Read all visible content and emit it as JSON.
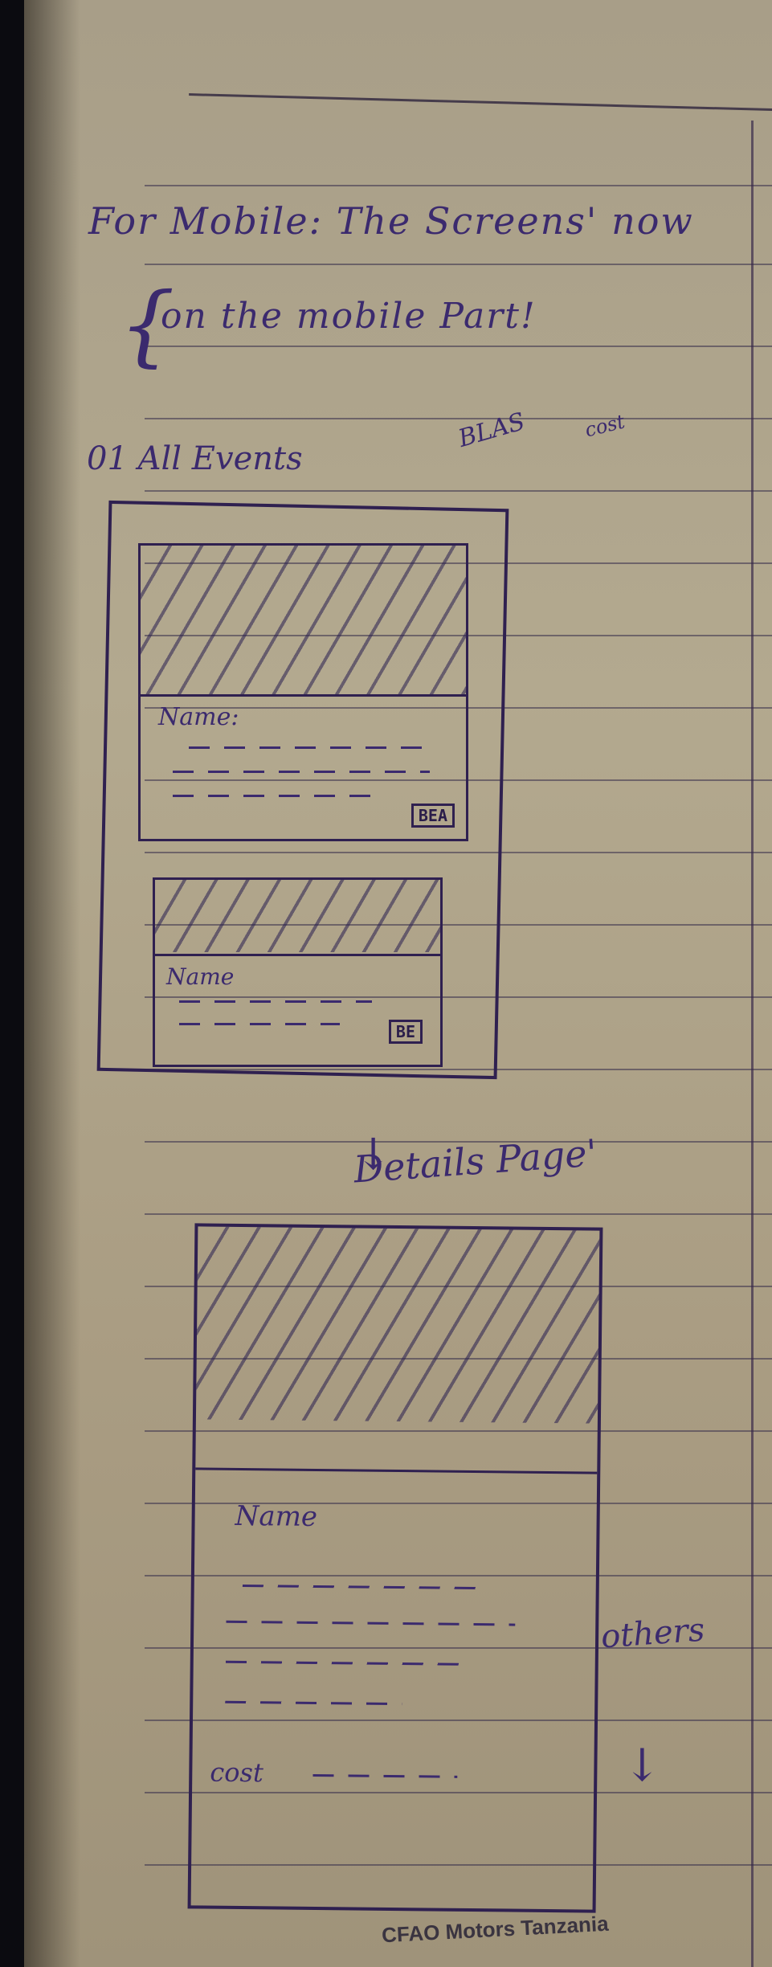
{
  "notes": {
    "line1": "For Mobile: The Screens' now",
    "line2": "on the mobile Part!",
    "bracket": "{",
    "events_heading": "01 All Events",
    "blas_note": "BLAS",
    "cost_note": "cost",
    "details_heading": "Details Page'",
    "details_arrow": "↓",
    "others": "others",
    "others_arrow": "↓"
  },
  "events_list": {
    "cards": [
      {
        "name_label": "Name:",
        "badge": "BEA"
      },
      {
        "name_label": "Name",
        "badge": "BE"
      }
    ]
  },
  "details_page": {
    "name_label": "Name",
    "cost_label": "cost"
  },
  "footer": {
    "text": "CFAO Motors Tanzania"
  },
  "colors": {
    "ink": "#3b2a6e",
    "paper": "#b3a98f"
  }
}
